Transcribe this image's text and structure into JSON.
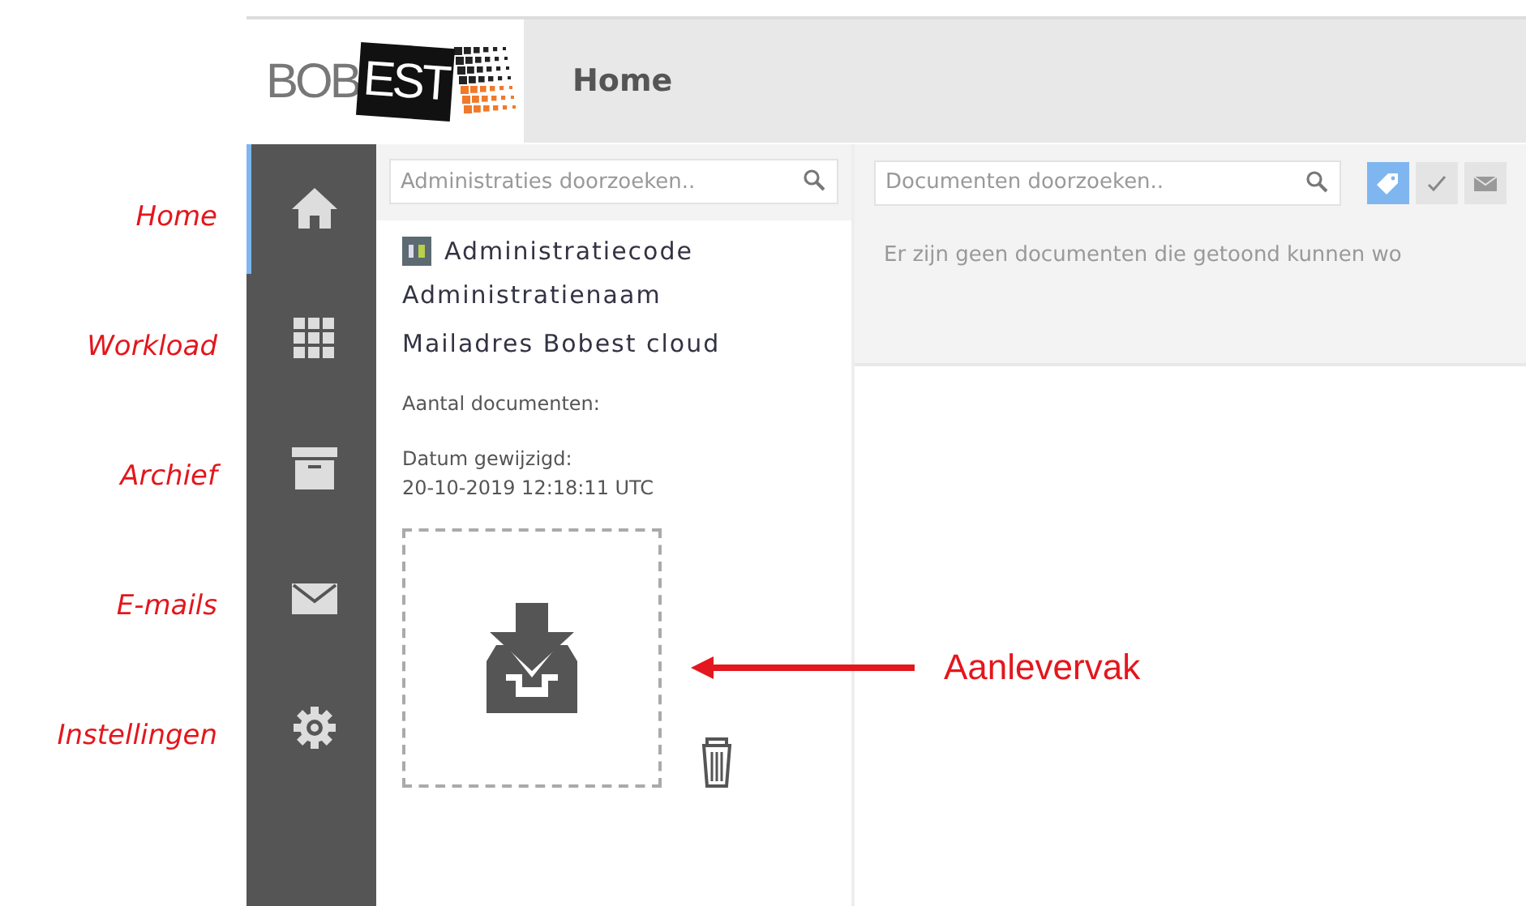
{
  "annotations": {
    "sidebar_labels": [
      "Home",
      "Workload",
      "Archief",
      "E-mails",
      "Instellingen"
    ],
    "callout": "Aanlevervak"
  },
  "header": {
    "logo": {
      "left": "BOB",
      "right": "EST"
    },
    "title": "Home"
  },
  "sidebar": {
    "items": [
      {
        "kind": "home",
        "selected": true
      },
      {
        "kind": "grid",
        "selected": false
      },
      {
        "kind": "archive",
        "selected": false
      },
      {
        "kind": "mail",
        "selected": false
      },
      {
        "kind": "gear",
        "selected": false
      }
    ]
  },
  "admin_panel": {
    "search": {
      "placeholder": "Administraties doorzoeken.."
    },
    "code": "Administratiecode",
    "name": "Administratienaam",
    "mail": "Mailadres Bobest cloud",
    "count_label": "Aantal documenten:",
    "date_label": "Datum gewijzigd:",
    "date": "20-10-2019 12:18:11 UTC"
  },
  "documents": {
    "search": {
      "placeholder": "Documenten doorzoeken.."
    },
    "filters": [
      {
        "kind": "tag",
        "selected": true
      },
      {
        "kind": "check",
        "selected": false
      },
      {
        "kind": "mail",
        "selected": false
      }
    ],
    "empty_message": "Er zijn geen documenten die getoond kunnen wo"
  }
}
